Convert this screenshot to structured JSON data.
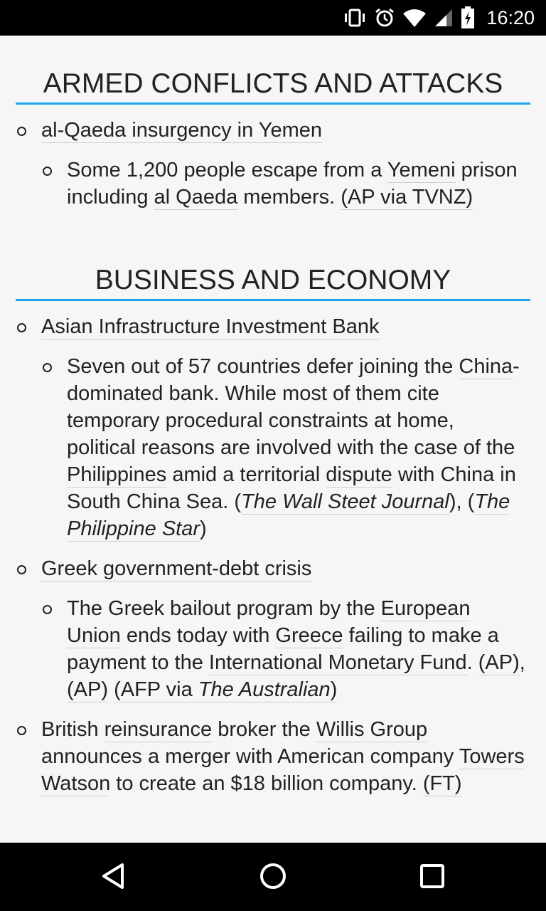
{
  "status_bar": {
    "time": "16:20"
  },
  "sections": [
    {
      "heading": "ARMED CONFLICTS AND ATTACKS"
    },
    {
      "heading": "BUSINESS AND ECONOMY"
    }
  ],
  "armed": {
    "topic1": "al-Qaeda insurgency in Yemen",
    "item1": {
      "t1": "Some 1,200 people escape from a ",
      "l1": "Yemeni",
      "t2": " prison including ",
      "l2": "al Qaeda",
      "t3": " members. ",
      "l3": "(AP via TVNZ)"
    }
  },
  "business": {
    "topic1": "Asian Infrastructure Investment Bank",
    "item1": {
      "t1": "Seven out of 57 countries defer joining the ",
      "l1": "China",
      "t2": "-dominated bank. While most of them cite temporary procedural constraints at home, political reasons are involved with the case of the ",
      "l2": "Philippines",
      "t3": " amid a territorial ",
      "l3": "dispute",
      "t4": " with China in South China Sea. (",
      "src1": "The Wall Steet Journal",
      "t5": "), (",
      "src2": "The Philippine Star",
      "t6": ")"
    },
    "topic2": "Greek government-debt crisis",
    "item2": {
      "t1": "The Greek bailout program by the ",
      "l1": "European Union",
      "t2": " ends today with ",
      "l2": "Greece",
      "t3": " failing to make a payment to the ",
      "l3": "International Monetary Fund",
      "t4": ". ",
      "src1": "(AP)",
      "t5": ", ",
      "src2": "(AP)",
      "t6": " ",
      "src3a": "(AFP via ",
      "src3b": "The Australian",
      "src3c": ")"
    },
    "item3": {
      "t1": "British ",
      "l1": "reinsurance",
      "t2": " broker the ",
      "l2": "Willis Group",
      "t3": " announces a merger with American company ",
      "l3": "Towers Watson",
      "t4": " to create an $18 billion company. ",
      "src1": "(FT)"
    }
  },
  "icons": {
    "status": [
      "vibrate-icon",
      "alarm-icon",
      "wifi-icon",
      "signal-icon",
      "battery-charging-icon"
    ],
    "nav": [
      "back-icon",
      "home-icon",
      "recents-icon"
    ]
  }
}
